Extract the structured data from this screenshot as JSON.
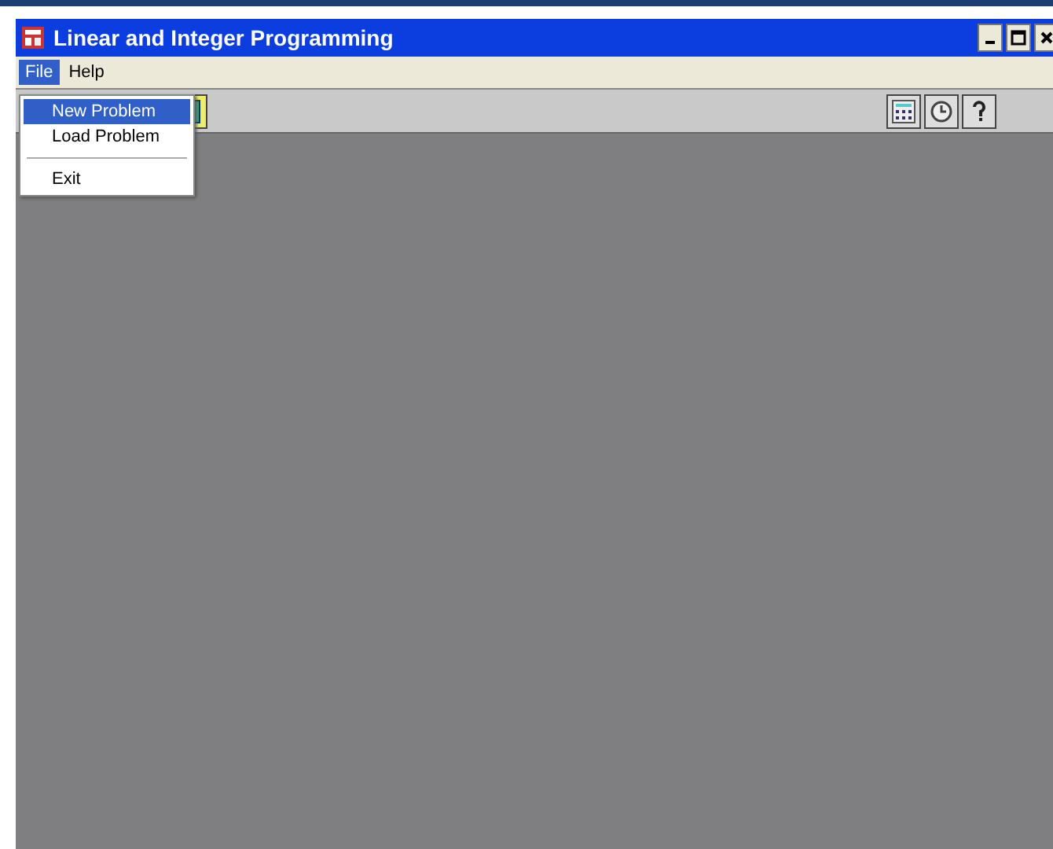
{
  "window": {
    "title": "Linear and Integer Programming"
  },
  "menu_bar": [
    {
      "label": "File",
      "selected": true
    },
    {
      "label": "Help",
      "selected": false
    }
  ],
  "file_menu": {
    "groups": [
      [
        {
          "label": "New Problem",
          "selected": true
        },
        {
          "label": "Load Problem",
          "selected": false
        }
      ],
      [
        {
          "label": "Exit",
          "selected": false
        }
      ]
    ]
  }
}
